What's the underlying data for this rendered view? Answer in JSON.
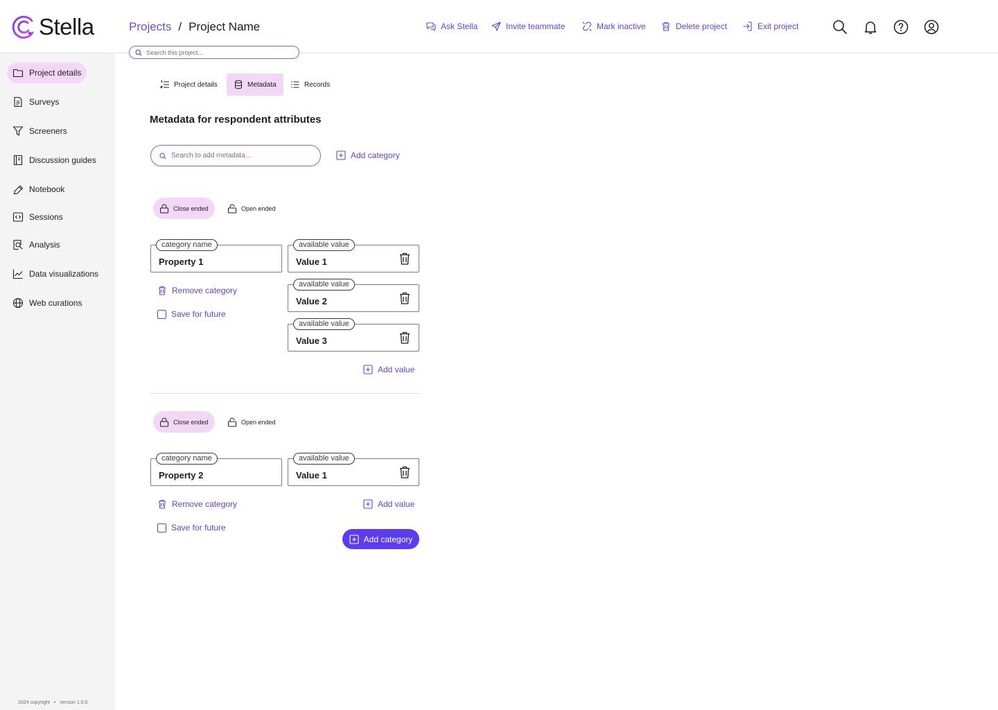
{
  "app": {
    "name": "Stella"
  },
  "breadcrumb": {
    "root": "Projects",
    "separator": "/",
    "current": "Project Name"
  },
  "header_actions": {
    "ask": "Ask Stella",
    "invite": "Invite teammate",
    "inactive": "Mark inactive",
    "delete": "Delete project",
    "exit": "Exit project"
  },
  "project_search": {
    "placeholder": "Search this project..."
  },
  "sidebar": {
    "items": [
      {
        "label": "Project details",
        "icon": "folder-icon"
      },
      {
        "label": "Surveys",
        "icon": "document-icon"
      },
      {
        "label": "Screeners",
        "icon": "filter-icon"
      },
      {
        "label": "Discussion guides",
        "icon": "book-icon"
      },
      {
        "label": "Notebook",
        "icon": "pen-icon"
      },
      {
        "label": "Sessions",
        "icon": "code-window-icon"
      },
      {
        "label": "Analysis",
        "icon": "magnify-doc-icon"
      },
      {
        "label": "Data visualizations",
        "icon": "line-chart-icon"
      },
      {
        "label": "Web curations",
        "icon": "globe-icon"
      }
    ],
    "footer": {
      "copyright": "2024 copyright",
      "bullet": "•",
      "version": "version 1.0.0"
    }
  },
  "tabs": [
    {
      "label": "Project details"
    },
    {
      "label": "Metadata"
    },
    {
      "label": "Records"
    }
  ],
  "metadata": {
    "title": "Metadata for respondent attributes",
    "search_placeholder": "Search to add metadata...",
    "add_category": "Add category",
    "close_ended": "Close ended",
    "open_ended": "Open ended",
    "category_label": "category name",
    "value_label": "available value",
    "remove_category": "Remove category",
    "save_for_future": "Save for future",
    "add_value": "Add value",
    "categories": [
      {
        "name": "Property 1",
        "values": [
          "Value 1",
          "Value 2",
          "Value 3"
        ]
      },
      {
        "name": "Property 2",
        "values": [
          "Value 1"
        ]
      }
    ]
  },
  "colors": {
    "accent": "#5c45e0",
    "active_bg": "#f2d8f6",
    "sidebar_bg": "#f4f4f5",
    "primary_btn": "#5b3cf0"
  }
}
